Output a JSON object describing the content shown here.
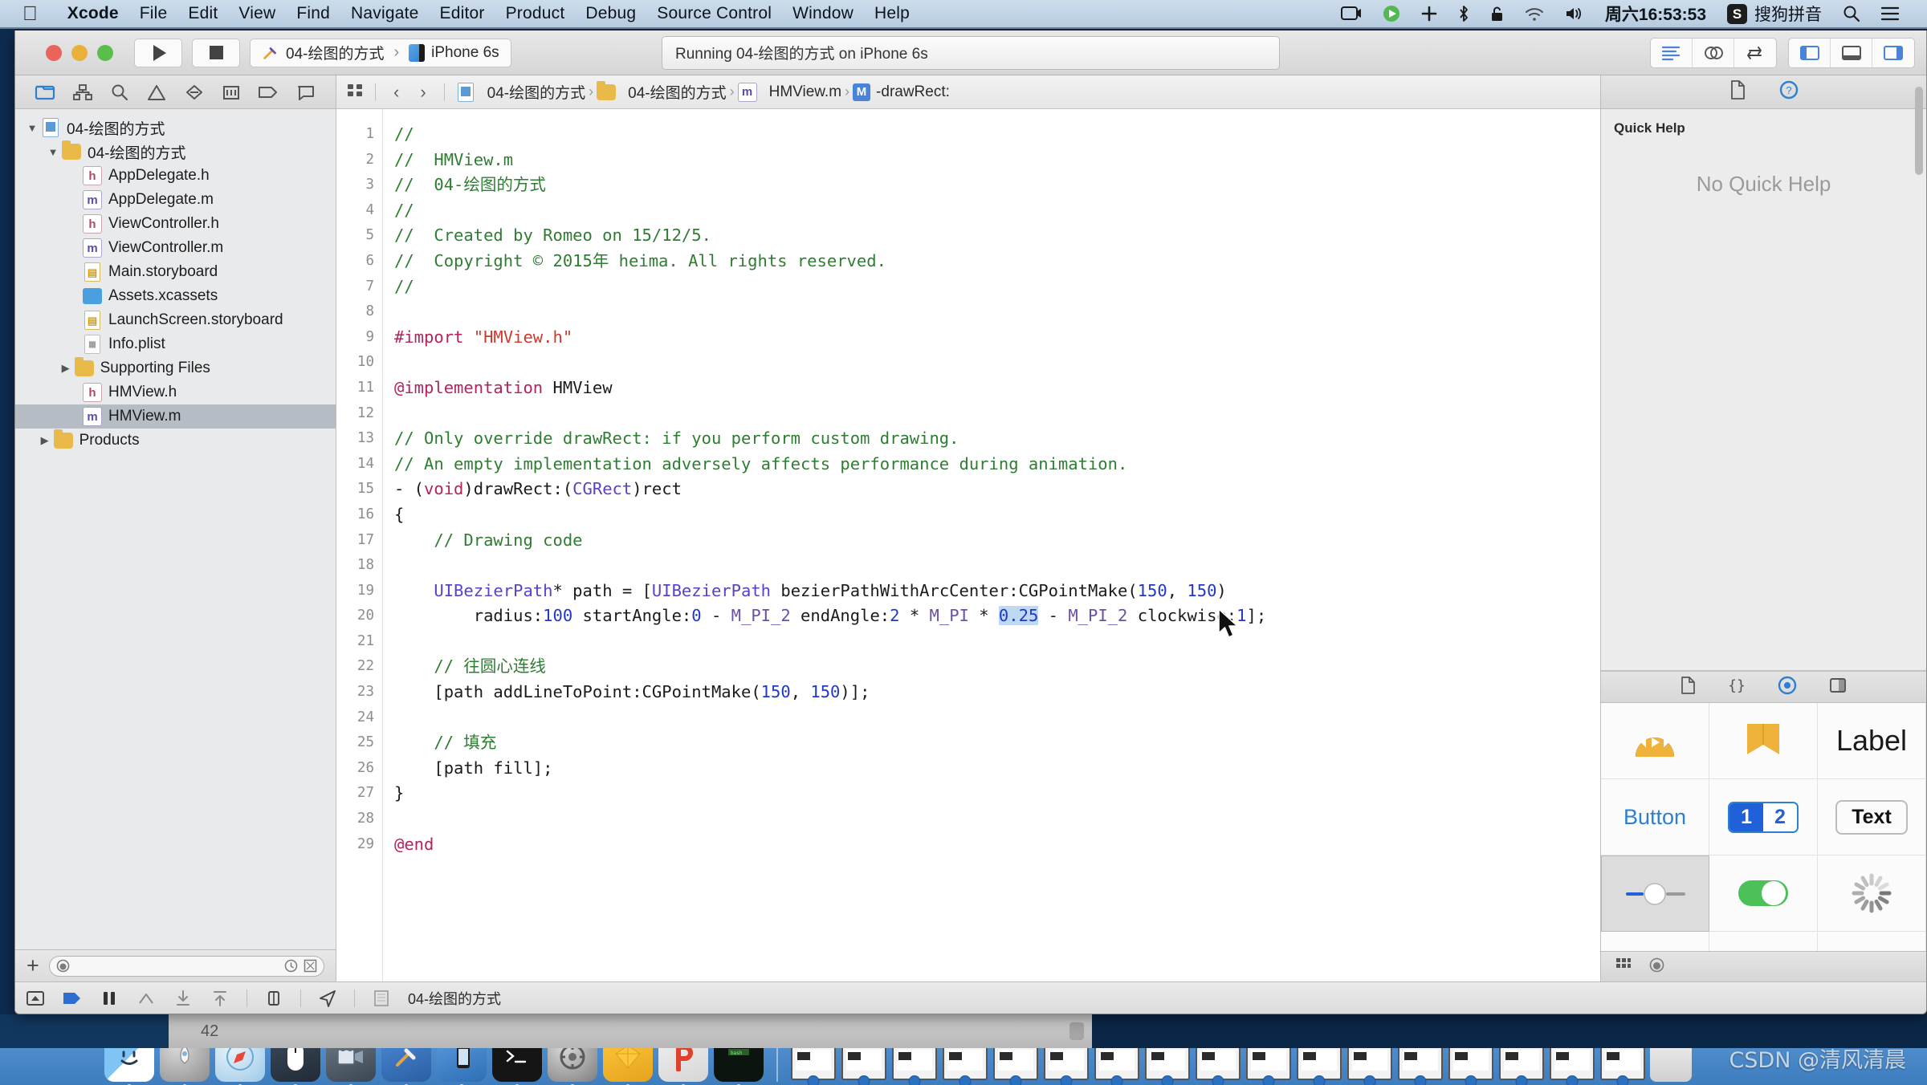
{
  "menubar": {
    "apple_icon": "apple-icon",
    "items": [
      "Xcode",
      "File",
      "Edit",
      "View",
      "Find",
      "Navigate",
      "Editor",
      "Product",
      "Debug",
      "Source Control",
      "Window",
      "Help"
    ],
    "status": {
      "screen_icon": "screen-record-icon",
      "play_icon": "media-play-icon",
      "plus_icon": "plus-icon",
      "bluetooth_icon": "bluetooth-icon",
      "lock_icon": "lock-icon",
      "wifi_icon": "wifi-icon",
      "volume_icon": "volume-icon",
      "clock": "周六16:53:53",
      "ime_badge": "S",
      "ime_label": "搜狗拼音",
      "search_icon": "spotlight-search-icon",
      "list_icon": "notification-center-icon"
    }
  },
  "toolbar": {
    "run_label": "run-button",
    "stop_label": "stop-button",
    "scheme_project": "04-绘图的方式",
    "scheme_device": "iPhone 6s",
    "status_text": "Running 04-绘图的方式 on iPhone 6s",
    "right_buttons": [
      "standard-editor-icon",
      "assistant-editor-icon",
      "version-editor-icon",
      "toggle-navigator-icon",
      "toggle-debug-area-icon",
      "toggle-utilities-icon"
    ]
  },
  "navigator": {
    "tabs": [
      "folder-icon",
      "hierarchy-icon",
      "search-icon",
      "warning-icon",
      "breakpoint-icon",
      "report-icon",
      "tag-icon",
      "comment-icon"
    ],
    "tree": [
      {
        "label": "04-绘图的方式",
        "indent": 0,
        "icon": "project",
        "disclosure": "open",
        "selected": false
      },
      {
        "label": "04-绘图的方式",
        "indent": 1,
        "icon": "folder",
        "disclosure": "open",
        "selected": false
      },
      {
        "label": "AppDelegate.h",
        "indent": 2,
        "icon": "h",
        "disclosure": "",
        "selected": false
      },
      {
        "label": "AppDelegate.m",
        "indent": 2,
        "icon": "m",
        "disclosure": "",
        "selected": false
      },
      {
        "label": "ViewController.h",
        "indent": 2,
        "icon": "h",
        "disclosure": "",
        "selected": false
      },
      {
        "label": "ViewController.m",
        "indent": 2,
        "icon": "m",
        "disclosure": "",
        "selected": false
      },
      {
        "label": "Main.storyboard",
        "indent": 2,
        "icon": "sb",
        "disclosure": "",
        "selected": false
      },
      {
        "label": "Assets.xcassets",
        "indent": 2,
        "icon": "xca",
        "disclosure": "",
        "selected": false
      },
      {
        "label": "LaunchScreen.storyboard",
        "indent": 2,
        "icon": "sb",
        "disclosure": "",
        "selected": false
      },
      {
        "label": "Info.plist",
        "indent": 2,
        "icon": "plist",
        "disclosure": "",
        "selected": false
      },
      {
        "label": "Supporting Files",
        "indent": 1.6,
        "icon": "folder",
        "disclosure": "closed",
        "selected": false
      },
      {
        "label": "HMView.h",
        "indent": 2,
        "icon": "h",
        "disclosure": "",
        "selected": false
      },
      {
        "label": "HMView.m",
        "indent": 2,
        "icon": "m",
        "disclosure": "",
        "selected": true
      },
      {
        "label": "Products",
        "indent": 0.6,
        "icon": "folder",
        "disclosure": "closed",
        "selected": false
      }
    ],
    "filter_placeholder": ""
  },
  "jumpbar": {
    "related_icon": "related-files-icon",
    "back_icon": "back-arrow-icon",
    "forward_icon": "forward-arrow-icon",
    "crumbs": [
      "04-绘图的方式",
      "04-绘图的方式",
      "HMView.m",
      "-drawRect:"
    ]
  },
  "editor": {
    "first_line": 1,
    "lines": [
      {
        "n": 1,
        "segs": [
          {
            "t": "//",
            "c": "cm"
          }
        ]
      },
      {
        "n": 2,
        "segs": [
          {
            "t": "//  HMView.m",
            "c": "cm"
          }
        ]
      },
      {
        "n": 3,
        "segs": [
          {
            "t": "//  04-绘图的方式",
            "c": "cm"
          }
        ]
      },
      {
        "n": 4,
        "segs": [
          {
            "t": "//",
            "c": "cm"
          }
        ]
      },
      {
        "n": 5,
        "segs": [
          {
            "t": "//  Created by Romeo on 15/12/5.",
            "c": "cm"
          }
        ]
      },
      {
        "n": 6,
        "segs": [
          {
            "t": "//  Copyright © 2015年 heima. All rights reserved.",
            "c": "cm"
          }
        ]
      },
      {
        "n": 7,
        "segs": [
          {
            "t": "//",
            "c": "cm"
          }
        ]
      },
      {
        "n": 8,
        "segs": []
      },
      {
        "n": 9,
        "segs": [
          {
            "t": "#import ",
            "c": "kw"
          },
          {
            "t": "\"HMView.h\"",
            "c": "st"
          }
        ]
      },
      {
        "n": 10,
        "segs": []
      },
      {
        "n": 11,
        "segs": [
          {
            "t": "@implementation",
            "c": "kw"
          },
          {
            "t": " HMView",
            "c": ""
          }
        ]
      },
      {
        "n": 12,
        "segs": []
      },
      {
        "n": 13,
        "segs": [
          {
            "t": "// Only override drawRect: if you perform custom drawing.",
            "c": "cm"
          }
        ]
      },
      {
        "n": 14,
        "segs": [
          {
            "t": "// An empty implementation adversely affects performance during animation.",
            "c": "cm"
          }
        ]
      },
      {
        "n": 15,
        "segs": [
          {
            "t": "- (",
            "c": ""
          },
          {
            "t": "void",
            "c": "kw"
          },
          {
            "t": ")drawRect:(",
            "c": ""
          },
          {
            "t": "CGRect",
            "c": "ty"
          },
          {
            "t": ")rect",
            "c": ""
          }
        ]
      },
      {
        "n": 16,
        "segs": [
          {
            "t": "{",
            "c": ""
          }
        ]
      },
      {
        "n": 17,
        "segs": [
          {
            "t": "    // Drawing code",
            "c": "cm"
          }
        ]
      },
      {
        "n": 18,
        "segs": []
      },
      {
        "n": 19,
        "segs": [
          {
            "t": "    ",
            "c": ""
          },
          {
            "t": "UIBezierPath",
            "c": "ty"
          },
          {
            "t": "* path = [",
            "c": ""
          },
          {
            "t": "UIBezierPath",
            "c": "ty"
          },
          {
            "t": " bezierPathWithArcCenter:CGPointMake(",
            "c": ""
          },
          {
            "t": "150",
            "c": "nu"
          },
          {
            "t": ", ",
            "c": ""
          },
          {
            "t": "150",
            "c": "nu"
          },
          {
            "t": ")",
            "c": ""
          }
        ]
      },
      {
        "n": "",
        "segs": [
          {
            "t": "        radius:",
            "c": ""
          },
          {
            "t": "100",
            "c": "nu"
          },
          {
            "t": " startAngle:",
            "c": ""
          },
          {
            "t": "0",
            "c": "nu"
          },
          {
            "t": " - ",
            "c": ""
          },
          {
            "t": "M_PI_2",
            "c": "mac"
          },
          {
            "t": " endAngle:",
            "c": ""
          },
          {
            "t": "2",
            "c": "nu"
          },
          {
            "t": " * ",
            "c": ""
          },
          {
            "t": "M_PI",
            "c": "mac"
          },
          {
            "t": " * ",
            "c": ""
          },
          {
            "t": "0.25",
            "c": "nu sel"
          },
          {
            "t": " - ",
            "c": ""
          },
          {
            "t": "M_PI_2",
            "c": "mac"
          },
          {
            "t": " clockwise:",
            "c": ""
          },
          {
            "t": "1",
            "c": "nu"
          },
          {
            "t": "];",
            "c": ""
          }
        ]
      },
      {
        "n": 20,
        "segs": []
      },
      {
        "n": 21,
        "segs": [
          {
            "t": "    // 往圆心连线",
            "c": "cm"
          }
        ]
      },
      {
        "n": 22,
        "segs": [
          {
            "t": "    [path addLineToPoint:CGPointMake(",
            "c": ""
          },
          {
            "t": "150",
            "c": "nu"
          },
          {
            "t": ", ",
            "c": ""
          },
          {
            "t": "150",
            "c": "nu"
          },
          {
            "t": ")];",
            "c": ""
          }
        ]
      },
      {
        "n": 23,
        "segs": []
      },
      {
        "n": 24,
        "segs": [
          {
            "t": "    // 填充",
            "c": "cm"
          }
        ]
      },
      {
        "n": 25,
        "segs": [
          {
            "t": "    [path fill];",
            "c": ""
          }
        ]
      },
      {
        "n": 26,
        "segs": [
          {
            "t": "}",
            "c": ""
          }
        ]
      },
      {
        "n": 27,
        "segs": []
      },
      {
        "n": 28,
        "segs": [
          {
            "t": "@end",
            "c": "kw"
          }
        ]
      },
      {
        "n": 29,
        "segs": []
      }
    ],
    "selected_token": "0.25"
  },
  "utility": {
    "tabs": [
      "file-inspector-icon",
      "quick-help-inspector-icon"
    ],
    "quick_help_title": "Quick Help",
    "quick_help_empty": "No Quick Help",
    "library_tabs": [
      "file-template-library-icon",
      "code-snippet-library-icon",
      "object-library-icon",
      "media-library-icon"
    ],
    "library_items": [
      {
        "label": "",
        "kind": "player",
        "selected": false
      },
      {
        "label": "",
        "kind": "banner",
        "selected": false
      },
      {
        "label": "Label",
        "kind": "label",
        "selected": false
      },
      {
        "label": "Button",
        "kind": "button",
        "selected": false
      },
      {
        "label": "1",
        "label2": "2",
        "kind": "segmented",
        "selected": false
      },
      {
        "label": "Text",
        "kind": "textfield",
        "selected": false
      },
      {
        "label": "",
        "kind": "slider",
        "selected": true
      },
      {
        "label": "",
        "kind": "switch",
        "selected": false
      },
      {
        "label": "",
        "kind": "spinner",
        "selected": false
      },
      {
        "label": "",
        "kind": "progress",
        "selected": false
      },
      {
        "label": "",
        "kind": "stepper",
        "selected": false
      },
      {
        "label": "",
        "kind": "page",
        "selected": false
      }
    ],
    "footer_icons": [
      "grid-view-icon",
      "library-filter-icon"
    ]
  },
  "debugbar": {
    "icons": [
      "hide-debug-area-icon",
      "continue-icon",
      "pause-icon",
      "step-over-icon",
      "step-into-icon",
      "step-out-icon",
      "simulate-location-icon",
      "view-hierarchy-icon",
      "process-icon"
    ],
    "process_label": "04-绘图的方式"
  },
  "desktop": {
    "window_number": "42",
    "dock_apps": [
      "finder-icon",
      "launchpad-icon",
      "safari-icon",
      "mouse-icon",
      "imovie-icon",
      "xcode-icon",
      "simulator-icon",
      "terminal-icon",
      "settings-icon",
      "sketch-icon",
      "paragon-icon",
      "iterm-icon"
    ],
    "taskbar_windows": 17,
    "trash_icon": "trash-icon",
    "watermark": "CSDN @清风清晨"
  },
  "colors": {
    "accent": "#2d7fd0",
    "selection": "#bfd9f5",
    "comment_green": "#2e7d32",
    "keyword_pink": "#b4225f",
    "string_red": "#cf3a2f",
    "number_blue": "#2038c8",
    "class_purple": "#5c3fc4",
    "dock_blue": "#4f8ccb"
  }
}
